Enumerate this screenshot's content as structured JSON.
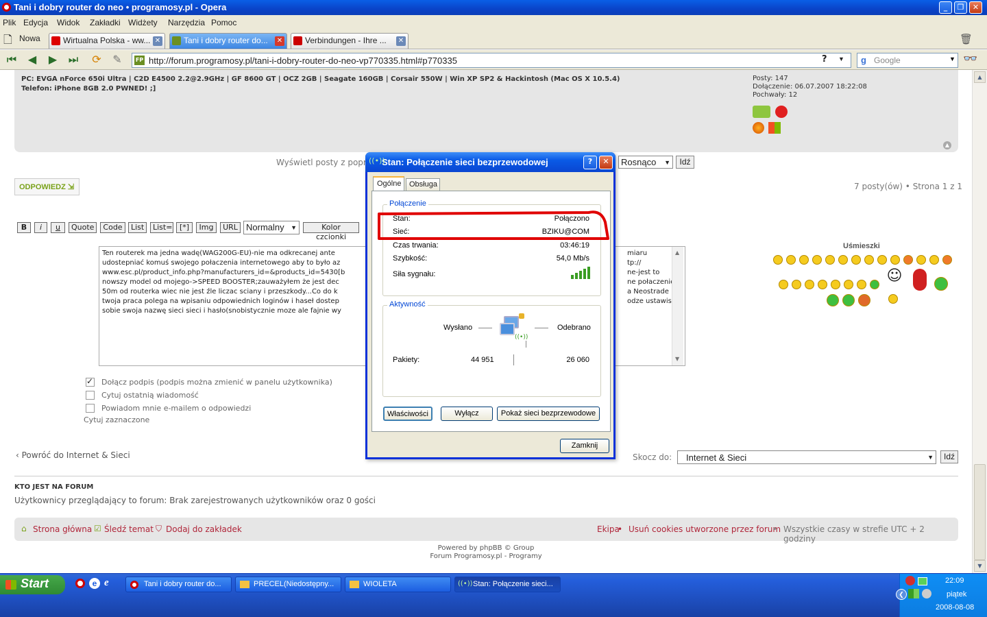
{
  "window": {
    "title": "Tani i dobry router do neo • programosy.pl - Opera"
  },
  "menu": [
    "Plik",
    "Edycja",
    "Widok",
    "Zakładki",
    "Widżety",
    "Narzędzia",
    "Pomoc"
  ],
  "tabs": {
    "new_label": "Nowa",
    "items": [
      {
        "label": "Wirtualna Polska - ww..."
      },
      {
        "label": "Tani i dobry router do..."
      },
      {
        "label": "Verbindungen - Ihre ..."
      }
    ]
  },
  "address": {
    "url": "http://forum.programosy.pl/tani-i-dobry-router-do-neo-vp770335.html#p770335",
    "search_placeholder": "Google"
  },
  "post": {
    "signature_pc": "PC: EVGA nForce 650i Ultra | C2D E4500 2.2@2.9GHz | GF 8600 GT | OCZ 2GB | Seagate 160GB | Corsair 550W | Win XP SP2 & Hackintosh (Mac OS X 10.5.4)",
    "signature_phone": "Telefon: iPhone 8GB 2.0 PWNED! ;]",
    "profile": {
      "posts": "Posty: 147",
      "joined_label": "Dołączenie: ",
      "joined_value": "06.07.2007 18:22:08",
      "thanks": "Pochwały: 12"
    }
  },
  "sort": {
    "label": "Wyświetl posty z popr",
    "order": "Rosnąco",
    "go": "Idź"
  },
  "reply_button": "ODPOWIEDZ",
  "pagination": "7 posty(ów) • Strona 1 z 1",
  "editor": {
    "buttons": [
      "B",
      "i",
      "u",
      "Quote",
      "Code",
      "List",
      "List=",
      "[*]",
      "Img",
      "URL"
    ],
    "font_size": "Normalny",
    "color_button": "Kolor czcionki",
    "text": "Ten routerek ma jedna wadę(WAG200G-EU)-nie ma odkrecanej ante\nudostepniać komuś swojego połaczenia internetowego aby to było az\nwww.esc.pl/product_info.php?manufacturers_id=&products_id=5430[b\nnowszy model od mojego->SPEED BOOSTER;zauważyłem że jest dec\n50m od routerka wiec nie jest źle liczac sciany i przeszkody...Co do k\ntwoja praca polega na wpisaniu odpowiednich loginów i haseł dostep\nsobie swoja nazwę sieci sieci i hasło(snobistycznie moze ale fajnie wy",
    "text_right": "miaru\ntp://\nne-jest to\nne połaczenie\na Neostrade i\nodze ustawisz"
  },
  "options": [
    {
      "label": "Dołącz podpis (podpis można zmienić w panelu użytkownika)",
      "checked": true
    },
    {
      "label": "Cytuj ostatnią wiadomość",
      "checked": false
    },
    {
      "label": "Powiadom mnie e-mailem o odpowiedzi",
      "checked": false
    }
  ],
  "quote_selected": "Cytuj zaznaczone",
  "smilies_title": "Uśmieszki",
  "back_link": "Powróć do Internet & Sieci",
  "jump": {
    "label": "Skocz do:",
    "value": "Internet & Sieci",
    "go": "Idź"
  },
  "who": {
    "title": "KTO JEST NA FORUM",
    "text": "Użytkownicy przeglądający to forum: Brak zarejestrowanych użytkowników oraz 0 gości"
  },
  "footer": {
    "home": "Strona główna",
    "watch": "Śledź temat",
    "bookmark": "Dodaj do zakładek",
    "team": "Ekipa",
    "sep": " • ",
    "cookies": "Usuń cookies utworzone przez forum",
    "timezone": "Wszystkie czasy w strefie UTC + 2 godziny",
    "powered": "Powered by phpBB © Group",
    "forum": "Forum Programosy.pl - Programy"
  },
  "dialog": {
    "title": "Stan: Połączenie sieci bezprzewodowej",
    "tabs": [
      "Ogólne",
      "Obsługa"
    ],
    "connection": {
      "legend": "Połączenie",
      "status_label": "Stan:",
      "status_value": "Połączono",
      "network_label": "Sieć:",
      "network_value": "BZIKU@COM",
      "duration_label": "Czas trwania:",
      "duration_value": "03:46:19",
      "speed_label": "Szybkość:",
      "speed_value": "54,0 Mb/s",
      "signal_label": "Siła sygnału:",
      "signal_strength_bars": 5
    },
    "activity": {
      "legend": "Aktywność",
      "sent_label": "Wysłano",
      "received_label": "Odebrano",
      "packets_label": "Pakiety:",
      "sent_value": "44 951",
      "received_value": "26 060"
    },
    "buttons": {
      "properties": "Właściwości",
      "disable": "Wyłącz",
      "show_networks": "Pokaż sieci bezprzewodowe",
      "close": "Zamknij"
    }
  },
  "taskbar": {
    "start": "Start",
    "tasks": [
      {
        "label": "Tani i dobry router do..."
      },
      {
        "label": "PRECEL(Niedostępny..."
      },
      {
        "label": "WIOLETA"
      },
      {
        "label": "Stan: Połączenie sieci..."
      }
    ],
    "clock": {
      "time": "22:09",
      "day": "piątek",
      "date": "2008-08-08"
    }
  }
}
